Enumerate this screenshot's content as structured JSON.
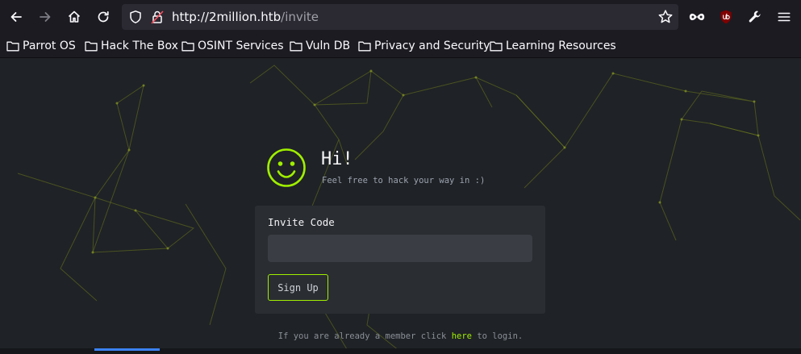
{
  "browser": {
    "url_host": "http://2million.htb",
    "url_path": "/invite",
    "bookmarks": [
      {
        "label": "Parrot OS"
      },
      {
        "label": "Hack The Box"
      },
      {
        "label": "OSINT Services"
      },
      {
        "label": "Vuln DB"
      },
      {
        "label": "Privacy and Security"
      },
      {
        "label": "Learning Resources"
      }
    ],
    "icons": {
      "back": "arrow-left-icon",
      "forward": "arrow-right-icon",
      "home": "home-icon",
      "reload": "reload-icon",
      "tracking": "shield-icon",
      "security": "lock-icon",
      "bookmark_star": "star-icon",
      "extension_1": "infinity-mask-icon",
      "extension_2": "ublock-origin-icon",
      "tools": "wrench-icon",
      "menu": "hamburger-menu-icon"
    }
  },
  "page": {
    "greeting": {
      "icon": "smiley-icon",
      "title": "Hi!",
      "subtitle": "Feel free to hack your way in :)"
    },
    "form": {
      "label": "Invite Code",
      "input_value": "",
      "button_label": "Sign Up"
    },
    "footer": {
      "prefix": "If you are already a member click ",
      "link_text": "here",
      "suffix": " to login."
    }
  },
  "colors": {
    "accent": "#9fef00",
    "page_bg": "#1f2226",
    "card_bg": "#2a2d32",
    "chrome_bg": "#1c1b22",
    "urlbar_bg": "#2b2a33"
  }
}
